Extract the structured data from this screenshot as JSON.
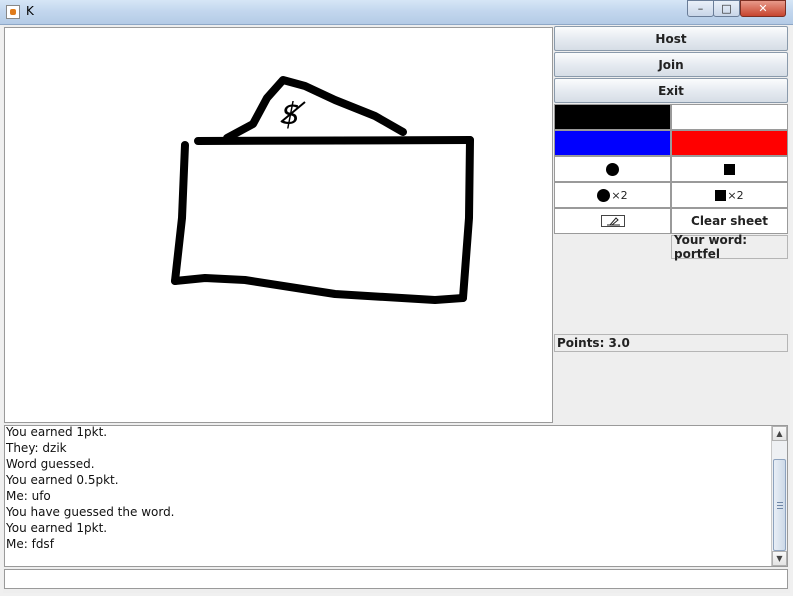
{
  "window": {
    "title": "K",
    "min": "–",
    "max": "□",
    "close": "✕"
  },
  "controls": {
    "host_label": "Host",
    "join_label": "Join",
    "exit_label": "Exit",
    "colors": [
      "#000000",
      "#ffffff",
      "#0000ff",
      "#ff0000"
    ],
    "brush_size_2": "×2",
    "square_size_2": "×2",
    "clear_label": "Clear sheet",
    "word_label": "Your word: portfel",
    "points_label": "Points: 3.0"
  },
  "canvas": {
    "doodle_text": "$"
  },
  "chat": {
    "lines": [
      "You earned 1pkt.",
      "They: dzik",
      "Word guessed.",
      "You earned 0.5pkt.",
      "Me: ufo",
      "You have guessed the word.",
      "You earned 1pkt.",
      "Me: fdsf"
    ]
  },
  "input": {
    "value": ""
  }
}
